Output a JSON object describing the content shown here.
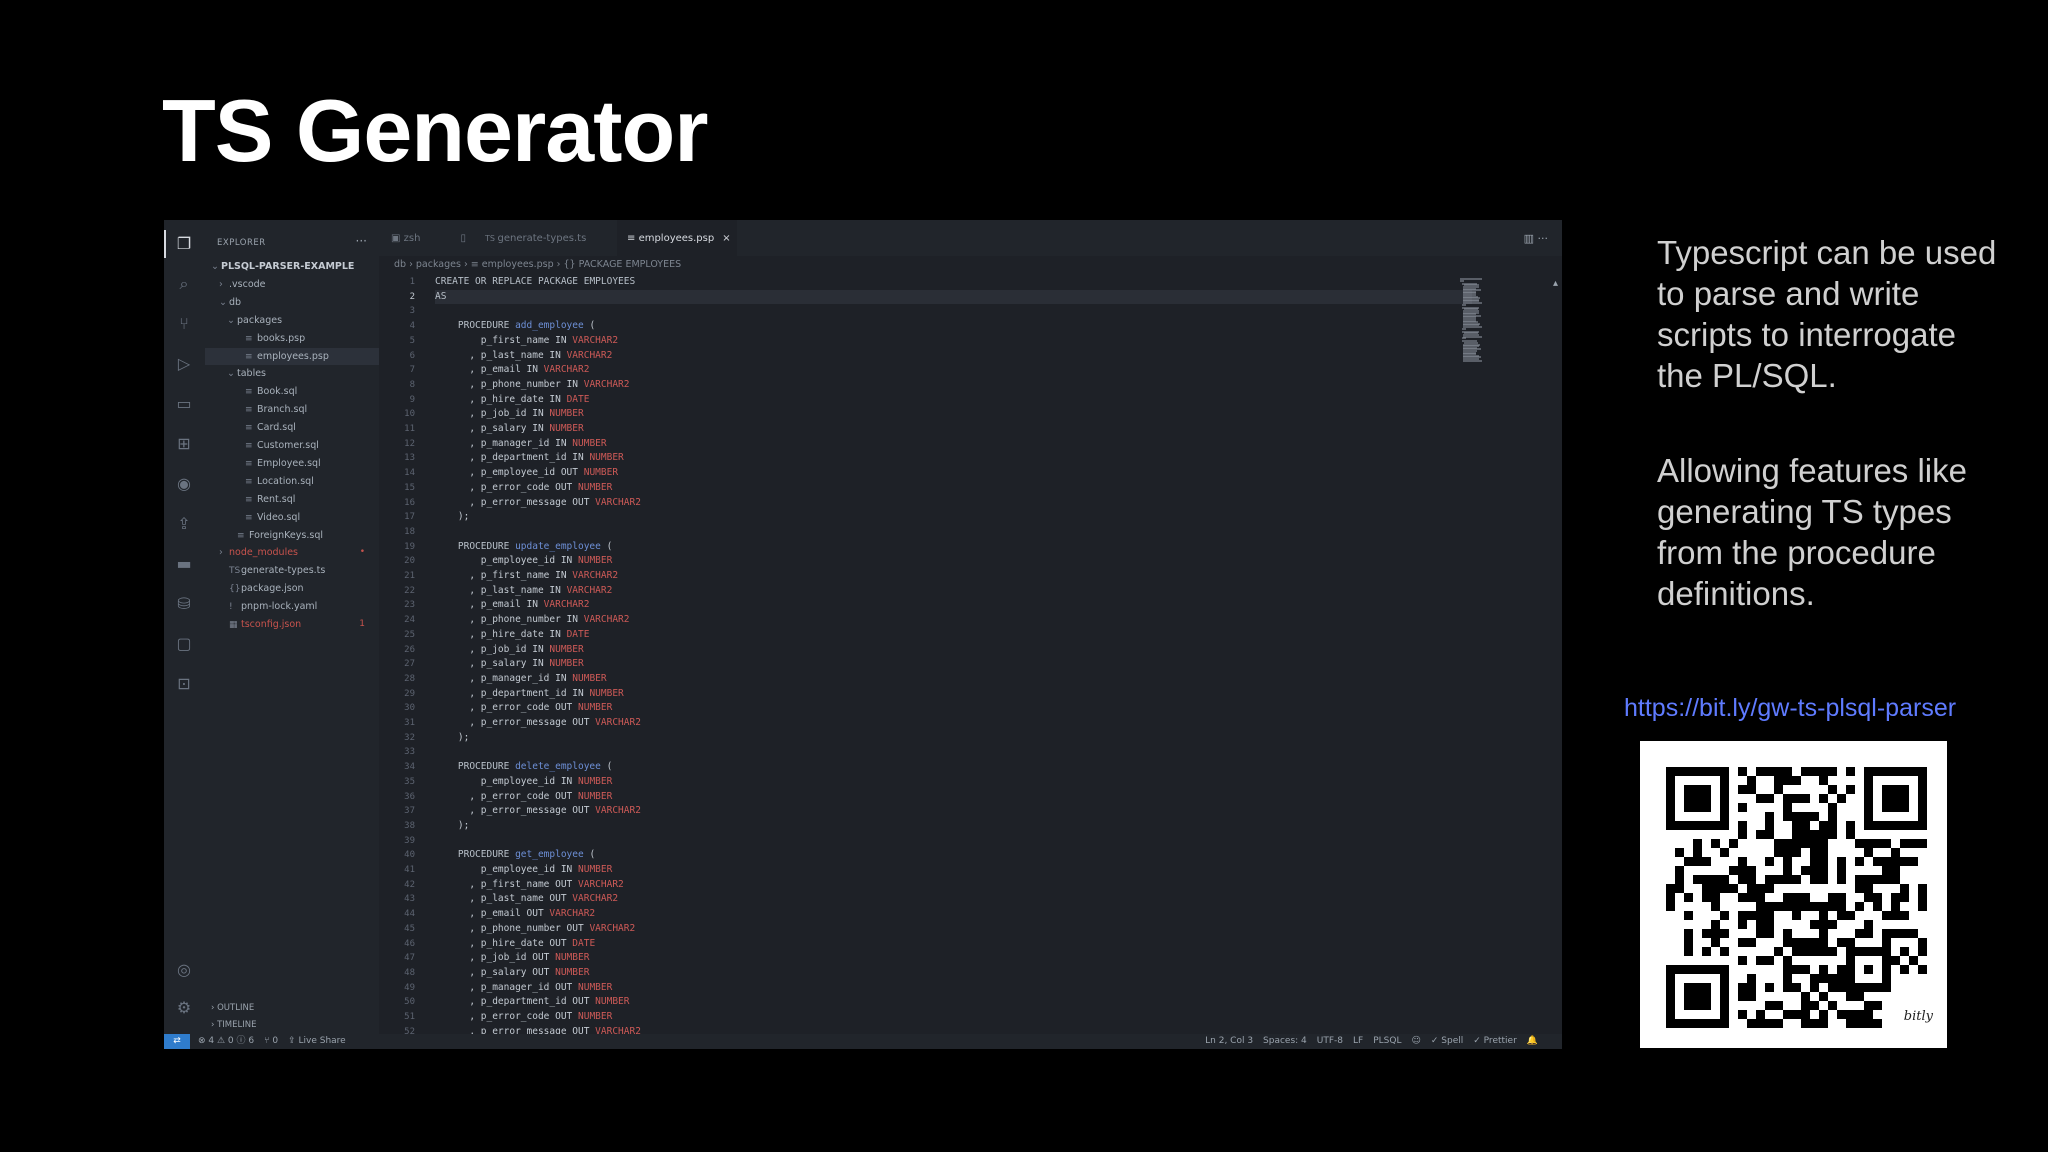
{
  "slide": {
    "title": "TS Generator",
    "paragraphs": [
      "Typescript can be used to parse and write scripts to interrogate the PL/SQL.",
      "Allowing features like generating TS types from the procedure definitions."
    ],
    "link": "https://bit.ly/gw-ts-plsql-parser",
    "qr_brand": "bitly"
  },
  "editor_window": {
    "explorer_title": "EXPLORER",
    "tree": [
      {
        "label": "PLSQL-PARSER-EXAMPLE",
        "twisty": "⌄",
        "icon": "",
        "depth": 0,
        "style": "bold"
      },
      {
        "label": ".vscode",
        "twisty": "›",
        "icon": "",
        "depth": 1,
        "style": ""
      },
      {
        "label": "db",
        "twisty": "⌄",
        "icon": "",
        "depth": 1,
        "style": ""
      },
      {
        "label": "packages",
        "twisty": "⌄",
        "icon": "",
        "depth": 2,
        "style": ""
      },
      {
        "label": "books.psp",
        "twisty": "",
        "icon": "≡",
        "depth": 3,
        "style": ""
      },
      {
        "label": "employees.psp",
        "twisty": "",
        "icon": "≡",
        "depth": 3,
        "style": "selected"
      },
      {
        "label": "tables",
        "twisty": "⌄",
        "icon": "",
        "depth": 2,
        "style": ""
      },
      {
        "label": "Book.sql",
        "twisty": "",
        "icon": "≡",
        "depth": 3,
        "style": ""
      },
      {
        "label": "Branch.sql",
        "twisty": "",
        "icon": "≡",
        "depth": 3,
        "style": ""
      },
      {
        "label": "Card.sql",
        "twisty": "",
        "icon": "≡",
        "depth": 3,
        "style": ""
      },
      {
        "label": "Customer.sql",
        "twisty": "",
        "icon": "≡",
        "depth": 3,
        "style": ""
      },
      {
        "label": "Employee.sql",
        "twisty": "",
        "icon": "≡",
        "depth": 3,
        "style": ""
      },
      {
        "label": "Location.sql",
        "twisty": "",
        "icon": "≡",
        "depth": 3,
        "style": ""
      },
      {
        "label": "Rent.sql",
        "twisty": "",
        "icon": "≡",
        "depth": 3,
        "style": ""
      },
      {
        "label": "Video.sql",
        "twisty": "",
        "icon": "≡",
        "depth": 3,
        "style": ""
      },
      {
        "label": "ForeignKeys.sql",
        "twisty": "",
        "icon": "≡",
        "depth": 2,
        "style": ""
      },
      {
        "label": "node_modules",
        "twisty": "›",
        "icon": "",
        "depth": 1,
        "style": "red",
        "badge": "•"
      },
      {
        "label": "generate-types.ts",
        "twisty": "",
        "icon": "TS",
        "depth": 1,
        "style": ""
      },
      {
        "label": "package.json",
        "twisty": "",
        "icon": "{}",
        "depth": 1,
        "style": ""
      },
      {
        "label": "pnpm-lock.yaml",
        "twisty": "",
        "icon": "!",
        "depth": 1,
        "style": ""
      },
      {
        "label": "tsconfig.json",
        "twisty": "",
        "icon": "▦",
        "depth": 1,
        "style": "red",
        "badge": "1"
      }
    ],
    "outline_label": "OUTLINE",
    "timeline_label": "TIMELINE",
    "tabs": [
      {
        "label": "zsh",
        "icon": "▣"
      },
      {
        "label": "generate-types.ts",
        "icon": "TS"
      },
      {
        "label": "employees.psp",
        "icon": "≡",
        "close": "×"
      }
    ],
    "breadcrumb": "db › packages › ≡ employees.psp › {} PACKAGE EMPLOYEES",
    "status_left": [
      "⊗ 4 ⚠ 0 ⓘ 6",
      "⑂ 0",
      "⇪ Live Share"
    ],
    "status_right": [
      "Ln 2, Col 3",
      "Spaces: 4",
      "UTF-8",
      "LF",
      "PLSQL",
      "☺",
      "✓ Spell",
      "✓ Prettier",
      "🔔"
    ]
  },
  "code_lines": [
    [
      {
        "t": "CREATE OR REPLACE PACKAGE ",
        "c": "kw"
      },
      {
        "t": "EMPLOYEES",
        "c": "kw"
      }
    ],
    [
      {
        "t": "AS",
        "c": "kw"
      }
    ],
    [],
    [
      {
        "t": "    PROCEDURE ",
        "c": "kw"
      },
      {
        "t": "add_employee",
        "c": "proc"
      },
      {
        "t": " (",
        "c": ""
      }
    ],
    [
      {
        "t": "        p_first_name IN ",
        "c": ""
      },
      {
        "t": "VARCHAR2",
        "c": "typ"
      }
    ],
    [
      {
        "t": "      , p_last_name IN ",
        "c": ""
      },
      {
        "t": "VARCHAR2",
        "c": "typ"
      }
    ],
    [
      {
        "t": "      , p_email IN ",
        "c": ""
      },
      {
        "t": "VARCHAR2",
        "c": "typ"
      }
    ],
    [
      {
        "t": "      , p_phone_number IN ",
        "c": ""
      },
      {
        "t": "VARCHAR2",
        "c": "typ"
      }
    ],
    [
      {
        "t": "      , p_hire_date IN ",
        "c": ""
      },
      {
        "t": "DATE",
        "c": "typ"
      }
    ],
    [
      {
        "t": "      , p_job_id IN ",
        "c": ""
      },
      {
        "t": "NUMBER",
        "c": "typ"
      }
    ],
    [
      {
        "t": "      , p_salary IN ",
        "c": ""
      },
      {
        "t": "NUMBER",
        "c": "typ"
      }
    ],
    [
      {
        "t": "      , p_manager_id IN ",
        "c": ""
      },
      {
        "t": "NUMBER",
        "c": "typ"
      }
    ],
    [
      {
        "t": "      , p_department_id IN ",
        "c": ""
      },
      {
        "t": "NUMBER",
        "c": "typ"
      }
    ],
    [
      {
        "t": "      , p_employee_id OUT ",
        "c": ""
      },
      {
        "t": "NUMBER",
        "c": "typ"
      }
    ],
    [
      {
        "t": "      , p_error_code OUT ",
        "c": ""
      },
      {
        "t": "NUMBER",
        "c": "typ"
      }
    ],
    [
      {
        "t": "      , p_error_message OUT ",
        "c": ""
      },
      {
        "t": "VARCHAR2",
        "c": "typ"
      }
    ],
    [
      {
        "t": "    );",
        "c": ""
      }
    ],
    [],
    [
      {
        "t": "    PROCEDURE ",
        "c": "kw"
      },
      {
        "t": "update_employee",
        "c": "proc"
      },
      {
        "t": " (",
        "c": ""
      }
    ],
    [
      {
        "t": "        p_employee_id IN ",
        "c": ""
      },
      {
        "t": "NUMBER",
        "c": "typ"
      }
    ],
    [
      {
        "t": "      , p_first_name IN ",
        "c": ""
      },
      {
        "t": "VARCHAR2",
        "c": "typ"
      }
    ],
    [
      {
        "t": "      , p_last_name IN ",
        "c": ""
      },
      {
        "t": "VARCHAR2",
        "c": "typ"
      }
    ],
    [
      {
        "t": "      , p_email IN ",
        "c": ""
      },
      {
        "t": "VARCHAR2",
        "c": "typ"
      }
    ],
    [
      {
        "t": "      , p_phone_number IN ",
        "c": ""
      },
      {
        "t": "VARCHAR2",
        "c": "typ"
      }
    ],
    [
      {
        "t": "      , p_hire_date IN ",
        "c": ""
      },
      {
        "t": "DATE",
        "c": "typ"
      }
    ],
    [
      {
        "t": "      , p_job_id IN ",
        "c": ""
      },
      {
        "t": "NUMBER",
        "c": "typ"
      }
    ],
    [
      {
        "t": "      , p_salary IN ",
        "c": ""
      },
      {
        "t": "NUMBER",
        "c": "typ"
      }
    ],
    [
      {
        "t": "      , p_manager_id IN ",
        "c": ""
      },
      {
        "t": "NUMBER",
        "c": "typ"
      }
    ],
    [
      {
        "t": "      , p_department_id IN ",
        "c": ""
      },
      {
        "t": "NUMBER",
        "c": "typ"
      }
    ],
    [
      {
        "t": "      , p_error_code OUT ",
        "c": ""
      },
      {
        "t": "NUMBER",
        "c": "typ"
      }
    ],
    [
      {
        "t": "      , p_error_message OUT ",
        "c": ""
      },
      {
        "t": "VARCHAR2",
        "c": "typ"
      }
    ],
    [
      {
        "t": "    );",
        "c": ""
      }
    ],
    [],
    [
      {
        "t": "    PROCEDURE ",
        "c": "kw"
      },
      {
        "t": "delete_employee",
        "c": "proc"
      },
      {
        "t": " (",
        "c": ""
      }
    ],
    [
      {
        "t": "        p_employee_id IN ",
        "c": ""
      },
      {
        "t": "NUMBER",
        "c": "typ"
      }
    ],
    [
      {
        "t": "      , p_error_code OUT ",
        "c": ""
      },
      {
        "t": "NUMBER",
        "c": "typ"
      }
    ],
    [
      {
        "t": "      , p_error_message OUT ",
        "c": ""
      },
      {
        "t": "VARCHAR2",
        "c": "typ"
      }
    ],
    [
      {
        "t": "    );",
        "c": ""
      }
    ],
    [],
    [
      {
        "t": "    PROCEDURE ",
        "c": "kw"
      },
      {
        "t": "get_employee",
        "c": "proc"
      },
      {
        "t": " (",
        "c": ""
      }
    ],
    [
      {
        "t": "        p_employee_id IN ",
        "c": ""
      },
      {
        "t": "NUMBER",
        "c": "typ"
      }
    ],
    [
      {
        "t": "      , p_first_name OUT ",
        "c": ""
      },
      {
        "t": "VARCHAR2",
        "c": "typ"
      }
    ],
    [
      {
        "t": "      , p_last_name OUT ",
        "c": ""
      },
      {
        "t": "VARCHAR2",
        "c": "typ"
      }
    ],
    [
      {
        "t": "      , p_email OUT ",
        "c": ""
      },
      {
        "t": "VARCHAR2",
        "c": "typ"
      }
    ],
    [
      {
        "t": "      , p_phone_number OUT ",
        "c": ""
      },
      {
        "t": "VARCHAR2",
        "c": "typ"
      }
    ],
    [
      {
        "t": "      , p_hire_date OUT ",
        "c": ""
      },
      {
        "t": "DATE",
        "c": "typ"
      }
    ],
    [
      {
        "t": "      , p_job_id OUT ",
        "c": ""
      },
      {
        "t": "NUMBER",
        "c": "typ"
      }
    ],
    [
      {
        "t": "      , p_salary OUT ",
        "c": ""
      },
      {
        "t": "NUMBER",
        "c": "typ"
      }
    ],
    [
      {
        "t": "      , p_manager_id OUT ",
        "c": ""
      },
      {
        "t": "NUMBER",
        "c": "typ"
      }
    ],
    [
      {
        "t": "      , p_department_id OUT ",
        "c": ""
      },
      {
        "t": "NUMBER",
        "c": "typ"
      }
    ],
    [
      {
        "t": "      , p_error_code OUT ",
        "c": ""
      },
      {
        "t": "NUMBER",
        "c": "typ"
      }
    ],
    [
      {
        "t": "      , p_error_message OUT ",
        "c": ""
      },
      {
        "t": "VARCHAR2",
        "c": "typ"
      }
    ]
  ],
  "current_line": 2,
  "colors": {
    "accent": "#2f7ccc",
    "link": "#5f7bff",
    "type": "#cd5a57",
    "procedure": "#6d8fd6"
  },
  "icons": [
    "files-icon",
    "search-icon",
    "source-control-icon",
    "run-debug-icon",
    "remote-explorer-icon",
    "extensions-icon",
    "github-icon",
    "docker-icon",
    "live-share-icon",
    "database-icon",
    "comments-icon",
    "account-icon",
    "settings-icon"
  ]
}
